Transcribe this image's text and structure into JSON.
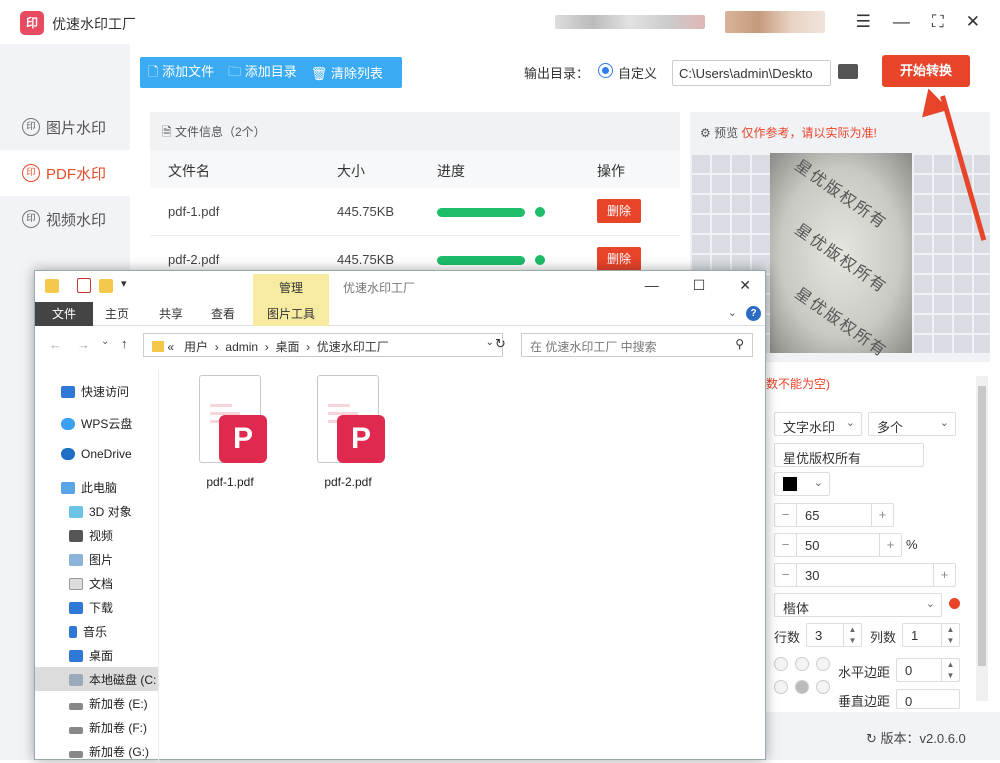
{
  "app": {
    "title": "优速水印工厂",
    "logo_text": "印",
    "version": "版本：v2.0.6.0"
  },
  "sidebar": {
    "items": [
      {
        "label": "图片水印",
        "active": false
      },
      {
        "label": "PDF水印",
        "active": true
      },
      {
        "label": "视频水印",
        "active": false
      }
    ]
  },
  "toolbar": {
    "add_file": "添加文件",
    "add_dir": "添加目录",
    "clear_list": "清除列表",
    "output_label": "输出目录：",
    "custom_label": "自定义",
    "output_path": "C:\\Users\\admin\\Deskto",
    "start_label": "开始转换"
  },
  "file_panel": {
    "info": "文件信息（2个）",
    "headers": {
      "name": "文件名",
      "size": "大小",
      "progress": "进度",
      "action": "操作"
    },
    "rows": [
      {
        "name": "pdf-1.pdf",
        "size": "445.75KB",
        "progress": 1.0,
        "action": "删除"
      },
      {
        "name": "pdf-2.pdf",
        "size": "445.75KB",
        "progress": 1.0,
        "action": "删除"
      }
    ]
  },
  "preview": {
    "label": "预览",
    "note": "仅作参考，请以实际为准!",
    "watermarks": [
      "星优版权所有",
      "星优版权所有",
      "星优版权所有"
    ]
  },
  "settings": {
    "note": "数不能为空)",
    "watermark_type": "文字水印",
    "count_mode": "多个",
    "text": "星优版权所有",
    "color": "#000000",
    "val1": "65",
    "val2": "50",
    "percent": "%",
    "val3": "30",
    "font": "楷体",
    "rows_label": "行数",
    "rows_value": "3",
    "cols_label": "列数",
    "cols_value": "1",
    "h_margin_label": "水平边距",
    "h_margin_value": "0",
    "v_margin_label": "垂直边距",
    "v_margin_value": "0"
  },
  "explorer": {
    "manage_tab": "管理",
    "title": "优速水印工厂",
    "ribbon": [
      "文件",
      "主页",
      "共享",
      "查看",
      "图片工具"
    ],
    "address": [
      "«",
      "用户",
      "admin",
      "桌面",
      "优速水印工厂"
    ],
    "search_placeholder": "在 优速水印工厂 中搜索",
    "nav": [
      "快速访问",
      "WPS云盘",
      "OneDrive",
      "此电脑",
      "3D 对象",
      "视频",
      "图片",
      "文档",
      "下载",
      "音乐",
      "桌面",
      "本地磁盘 (C:",
      "新加卷 (E:)",
      "新加卷 (F:)",
      "新加卷 (G:)"
    ],
    "files": [
      "pdf-1.pdf",
      "pdf-2.pdf"
    ]
  },
  "colors": {
    "accent": "#e8442a",
    "toolbar": "#3aabf2",
    "progress": "#1dbd6a",
    "pdf_badge": "#e0294f"
  }
}
